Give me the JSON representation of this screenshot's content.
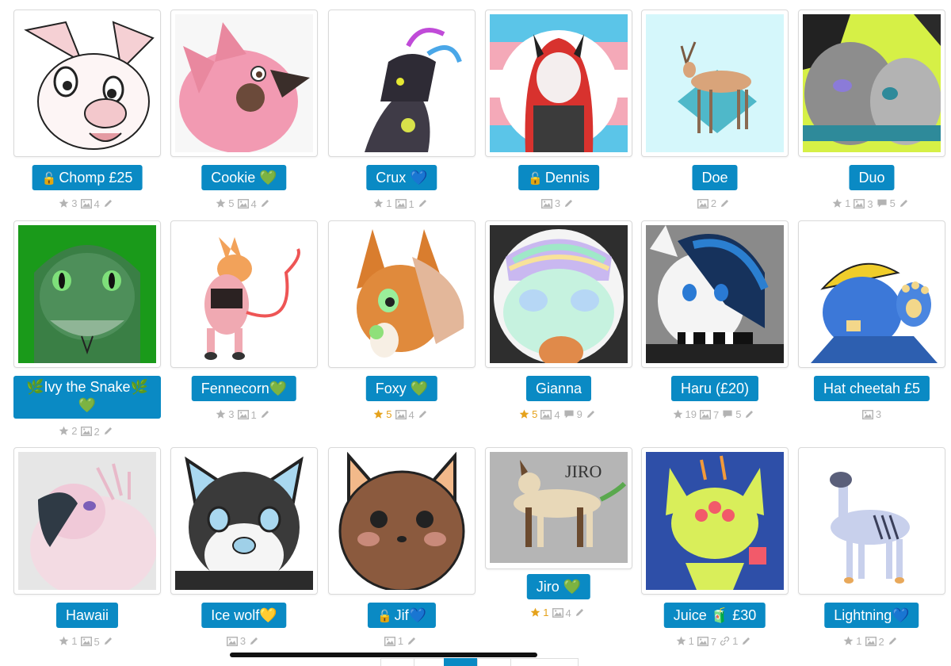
{
  "characters": [
    {
      "name": "Chomp £25",
      "locked": true,
      "stats": [
        {
          "icon": "star",
          "value": "3"
        },
        {
          "icon": "image",
          "value": "4"
        },
        {
          "icon": "pencil",
          "value": ""
        }
      ]
    },
    {
      "name": "Cookie 💚",
      "locked": false,
      "stats": [
        {
          "icon": "star",
          "value": "5"
        },
        {
          "icon": "image",
          "value": "4"
        },
        {
          "icon": "pencil",
          "value": ""
        }
      ]
    },
    {
      "name": "Crux 💙",
      "locked": false,
      "stats": [
        {
          "icon": "star",
          "value": "1"
        },
        {
          "icon": "image",
          "value": "1"
        },
        {
          "icon": "pencil",
          "value": ""
        }
      ]
    },
    {
      "name": "Dennis",
      "locked": true,
      "stats": [
        {
          "icon": "image",
          "value": "3"
        },
        {
          "icon": "pencil",
          "value": ""
        }
      ]
    },
    {
      "name": "Doe",
      "locked": false,
      "stats": [
        {
          "icon": "image",
          "value": "2"
        },
        {
          "icon": "pencil",
          "value": ""
        }
      ]
    },
    {
      "name": "Duo",
      "locked": false,
      "stats": [
        {
          "icon": "star",
          "value": "1"
        },
        {
          "icon": "image",
          "value": "3"
        },
        {
          "icon": "comment",
          "value": "5"
        },
        {
          "icon": "pencil",
          "value": ""
        }
      ]
    },
    {
      "name": "🌿Ivy the Snake🌿💚",
      "locked": false,
      "stats": [
        {
          "icon": "star",
          "value": "2"
        },
        {
          "icon": "image",
          "value": "2"
        },
        {
          "icon": "pencil",
          "value": ""
        }
      ]
    },
    {
      "name": "Fennecorn💚",
      "locked": false,
      "stats": [
        {
          "icon": "star",
          "value": "3"
        },
        {
          "icon": "image",
          "value": "1"
        },
        {
          "icon": "pencil",
          "value": ""
        }
      ]
    },
    {
      "name": "Foxy 💚",
      "locked": false,
      "stats": [
        {
          "icon": "star-gold",
          "value": "5"
        },
        {
          "icon": "image",
          "value": "4"
        },
        {
          "icon": "pencil",
          "value": ""
        }
      ]
    },
    {
      "name": "Gianna",
      "locked": false,
      "stats": [
        {
          "icon": "star-gold",
          "value": "5"
        },
        {
          "icon": "image",
          "value": "4"
        },
        {
          "icon": "comment",
          "value": "9"
        },
        {
          "icon": "pencil",
          "value": ""
        }
      ]
    },
    {
      "name": "Haru (£20)",
      "locked": false,
      "stats": [
        {
          "icon": "star",
          "value": "19"
        },
        {
          "icon": "image",
          "value": "7"
        },
        {
          "icon": "comment",
          "value": "5"
        },
        {
          "icon": "pencil",
          "value": ""
        }
      ]
    },
    {
      "name": "Hat cheetah £5",
      "locked": false,
      "stats": [
        {
          "icon": "image",
          "value": "3"
        }
      ]
    },
    {
      "name": "Hawaii",
      "locked": false,
      "stats": [
        {
          "icon": "star",
          "value": "1"
        },
        {
          "icon": "image",
          "value": "5"
        },
        {
          "icon": "pencil",
          "value": ""
        }
      ]
    },
    {
      "name": "Ice wolf💛",
      "locked": false,
      "stats": [
        {
          "icon": "image",
          "value": "3"
        },
        {
          "icon": "pencil",
          "value": ""
        }
      ]
    },
    {
      "name": "Jif💙",
      "locked": true,
      "stats": [
        {
          "icon": "image",
          "value": "1"
        },
        {
          "icon": "pencil",
          "value": ""
        }
      ]
    },
    {
      "name": "Jiro 💚",
      "locked": false,
      "stats": [
        {
          "icon": "star-gold",
          "value": "1"
        },
        {
          "icon": "image",
          "value": "4"
        },
        {
          "icon": "pencil",
          "value": ""
        }
      ]
    },
    {
      "name": "Juice 🧃 £30",
      "locked": false,
      "stats": [
        {
          "icon": "star",
          "value": "1"
        },
        {
          "icon": "image",
          "value": "7"
        },
        {
          "icon": "link",
          "value": "1"
        },
        {
          "icon": "pencil",
          "value": ""
        }
      ]
    },
    {
      "name": "Lightning💙",
      "locked": false,
      "stats": [
        {
          "icon": "star",
          "value": "1"
        },
        {
          "icon": "image",
          "value": "2"
        },
        {
          "icon": "pencil",
          "value": ""
        }
      ]
    }
  ],
  "colors": {
    "accent": "#0a8ac4",
    "stat_gray": "#b3b3b3",
    "star_gold": "#e5a21c"
  },
  "pagination": {
    "current_page": "",
    "visible_pages": [
      "",
      "",
      ""
    ]
  }
}
